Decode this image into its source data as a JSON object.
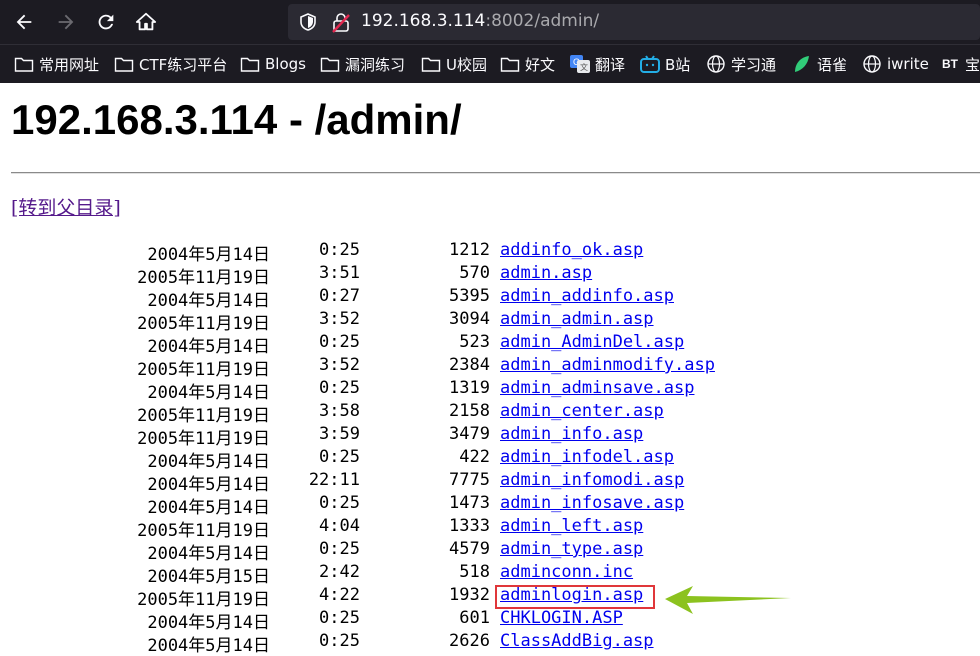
{
  "browser": {
    "url_host": "192.168.3.114",
    "url_rest": ":8002/admin/",
    "bookmarks": [
      {
        "label": "常用网址",
        "icon": "folder-icon"
      },
      {
        "label": "CTF练习平台",
        "icon": "folder-icon"
      },
      {
        "label": "Blogs",
        "icon": "folder-icon"
      },
      {
        "label": "漏洞练习",
        "icon": "folder-icon"
      },
      {
        "label": "U校园",
        "icon": "folder-icon"
      },
      {
        "label": "好文",
        "icon": "folder-icon"
      },
      {
        "label": "翻译",
        "icon": "translate-icon"
      },
      {
        "label": "B站",
        "icon": "bilibili-icon"
      },
      {
        "label": "学习通",
        "icon": "globe-icon"
      },
      {
        "label": "语雀",
        "icon": "yuque-icon"
      },
      {
        "label": "iwrite",
        "icon": "globe-icon"
      },
      {
        "label": "宝",
        "icon": "bt-icon"
      }
    ],
    "bt_badge": "BT"
  },
  "page": {
    "title": "192.168.3.114 - /admin/",
    "parent_link": "[转到父目录]",
    "files": [
      {
        "date": "2004年5月14日",
        "time": "0:25",
        "size": "1212",
        "name": "addinfo_ok.asp"
      },
      {
        "date": "2005年11月19日",
        "time": "3:51",
        "size": "570",
        "name": "admin.asp"
      },
      {
        "date": "2004年5月14日",
        "time": "0:27",
        "size": "5395",
        "name": "admin_addinfo.asp"
      },
      {
        "date": "2005年11月19日",
        "time": "3:52",
        "size": "3094",
        "name": "admin_admin.asp"
      },
      {
        "date": "2004年5月14日",
        "time": "0:25",
        "size": "523",
        "name": "admin_AdminDel.asp"
      },
      {
        "date": "2005年11月19日",
        "time": "3:52",
        "size": "2384",
        "name": "admin_adminmodify.asp"
      },
      {
        "date": "2004年5月14日",
        "time": "0:25",
        "size": "1319",
        "name": "admin_adminsave.asp"
      },
      {
        "date": "2005年11月19日",
        "time": "3:58",
        "size": "2158",
        "name": "admin_center.asp"
      },
      {
        "date": "2005年11月19日",
        "time": "3:59",
        "size": "3479",
        "name": "admin_info.asp"
      },
      {
        "date": "2004年5月14日",
        "time": "0:25",
        "size": "422",
        "name": "admin_infodel.asp"
      },
      {
        "date": "2004年5月14日",
        "time": "22:11",
        "size": "7775",
        "name": "admin_infomodi.asp"
      },
      {
        "date": "2004年5月14日",
        "time": "0:25",
        "size": "1473",
        "name": "admin_infosave.asp"
      },
      {
        "date": "2005年11月19日",
        "time": "4:04",
        "size": "1333",
        "name": "admin_left.asp"
      },
      {
        "date": "2004年5月14日",
        "time": "0:25",
        "size": "4579",
        "name": "admin_type.asp"
      },
      {
        "date": "2004年5月15日",
        "time": "2:42",
        "size": "518",
        "name": "adminconn.inc"
      },
      {
        "date": "2005年11月19日",
        "time": "4:22",
        "size": "1932",
        "name": "adminlogin.asp"
      },
      {
        "date": "2004年5月14日",
        "time": "0:25",
        "size": "601",
        "name": "CHKLOGIN.ASP"
      },
      {
        "date": "2004年5月14日",
        "time": "0:25",
        "size": "2626",
        "name": "ClassAddBig.asp"
      }
    ]
  },
  "annotation": {
    "highlight_color": "#e0373a",
    "arrow_color": "#8cc21f"
  }
}
